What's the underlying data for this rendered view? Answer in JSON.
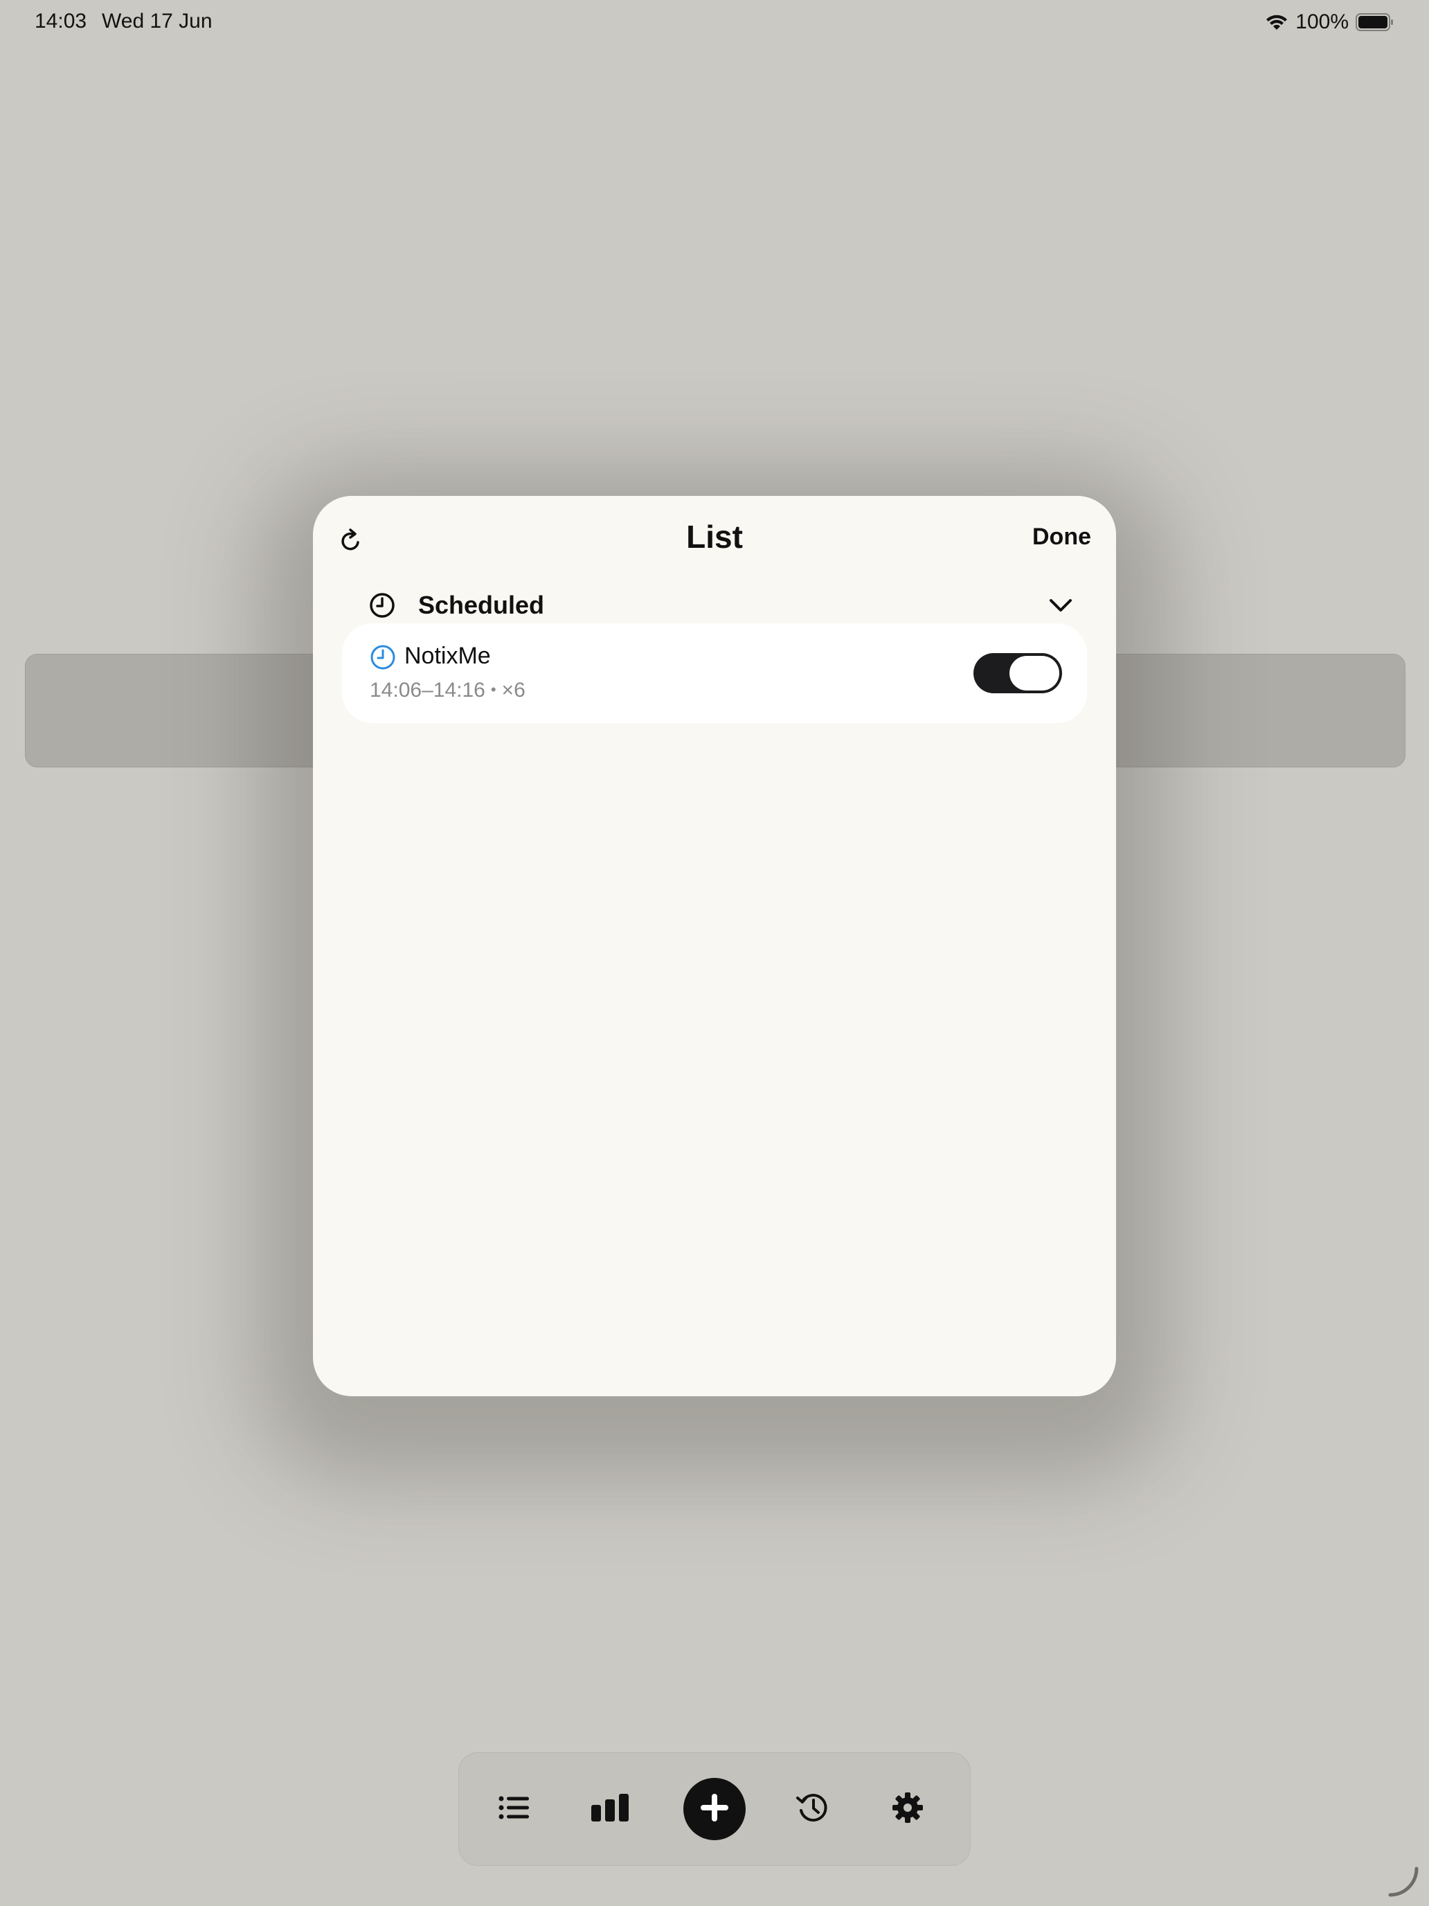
{
  "status_bar": {
    "time": "14:03",
    "date": "Wed 17 Jun",
    "battery": "100%",
    "icons": [
      "wifi-icon",
      "battery-icon"
    ]
  },
  "sheet": {
    "title": "List",
    "done_label": "Done",
    "refresh_icon": "refresh-icon",
    "section": {
      "title": "Scheduled",
      "icon": "clock-icon",
      "chevron": "chevron-down-icon"
    },
    "items": [
      {
        "title": "NotixMe",
        "time_range": "14:06–14:16",
        "separator": "•",
        "count": "×6",
        "icon": "clock-icon",
        "icon_color": "#2a8be0",
        "enabled": true
      }
    ]
  },
  "tab_bar": {
    "tabs": [
      {
        "icon": "list-icon"
      },
      {
        "icon": "bar-chart-icon"
      },
      {
        "icon": "plus-icon"
      },
      {
        "icon": "history-icon"
      },
      {
        "icon": "gear-icon"
      }
    ]
  },
  "colors": {
    "background": "#cbc9c3",
    "sheet": "#faf8f2",
    "accent_clock": "#2a8be0",
    "toggle_on": "#1c1c1e"
  }
}
